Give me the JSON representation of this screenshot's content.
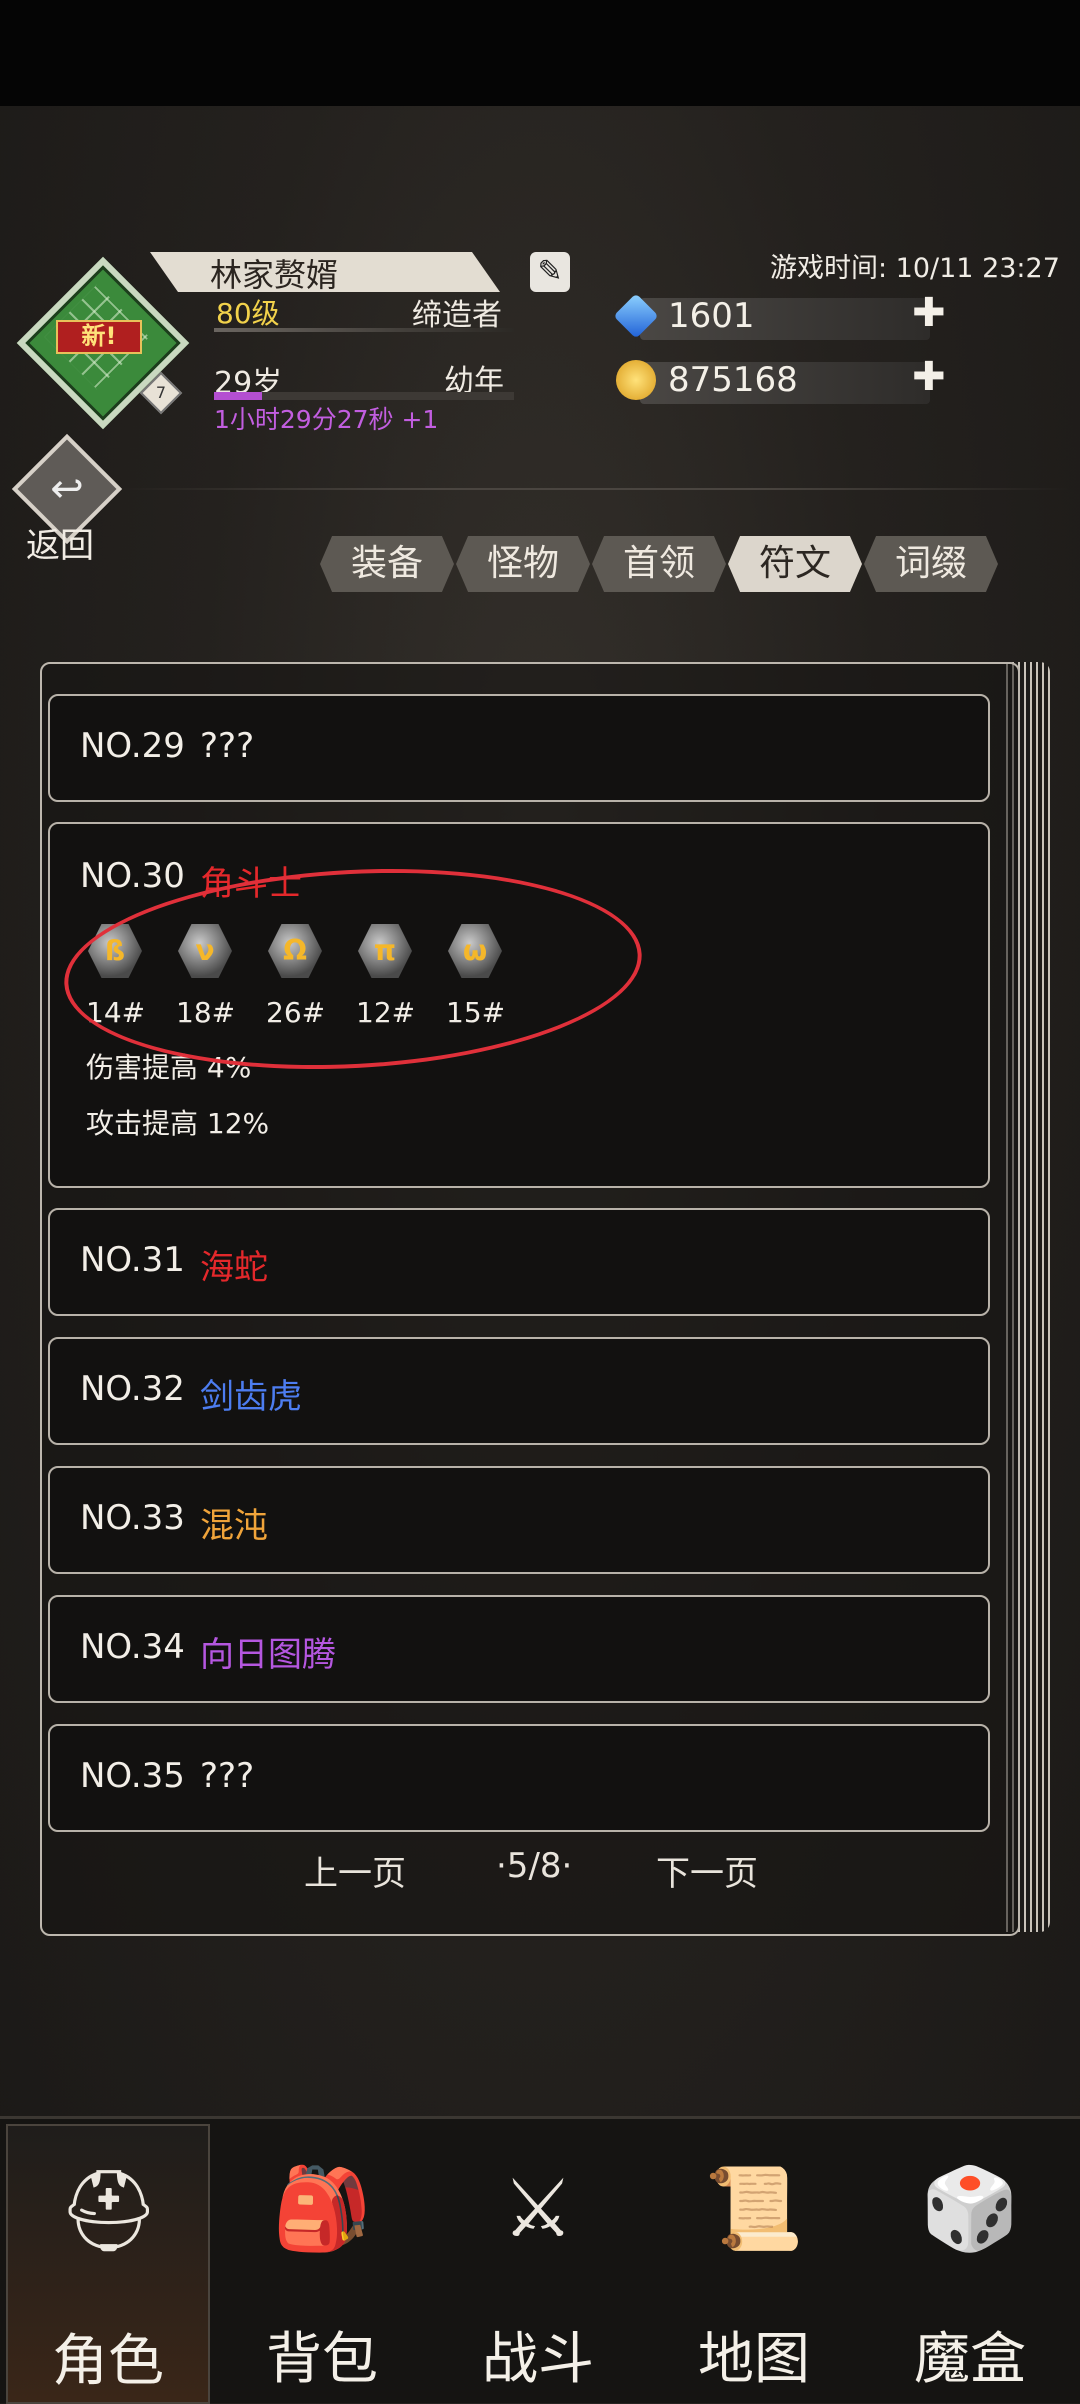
{
  "player": {
    "avatar_badge": "新!",
    "avatar_level": "7",
    "name": "林家赘婿",
    "level": "80级",
    "title": "缔造者",
    "age": "29岁",
    "stage": "幼年",
    "age_progress": 0.16,
    "timer": "1小时29分27秒 +1"
  },
  "game_time": "游戏时间: 10/11 23:27",
  "resources": {
    "gems": "1601",
    "gold": "875168"
  },
  "back_label": "返回",
  "tabs": [
    "装备",
    "怪物",
    "首领",
    "符文",
    "词缀"
  ],
  "active_tab": "符文",
  "entries": [
    {
      "no": "NO.29",
      "name": "???",
      "color": "#f2eee7"
    },
    {
      "no": "NO.30",
      "name": "角斗士",
      "color": "#e4282b",
      "runes": [
        {
          "glyph": "ß",
          "num": "14#"
        },
        {
          "glyph": "ν",
          "num": "18#"
        },
        {
          "glyph": "Ω",
          "num": "26#"
        },
        {
          "glyph": "π",
          "num": "12#"
        },
        {
          "glyph": "ω",
          "num": "15#"
        }
      ],
      "effects": [
        "伤害提高 4%",
        "攻击提高 12%"
      ]
    },
    {
      "no": "NO.31",
      "name": "海蛇",
      "color": "#e4282b"
    },
    {
      "no": "NO.32",
      "name": "剑齿虎",
      "color": "#4d7df0"
    },
    {
      "no": "NO.33",
      "name": "混沌",
      "color": "#f0a43a"
    },
    {
      "no": "NO.34",
      "name": "向日图腾",
      "color": "#b557e0"
    },
    {
      "no": "NO.35",
      "name": "???",
      "color": "#f2eee7"
    }
  ],
  "pager": {
    "prev": "上一页",
    "page": "·5/8·",
    "next": "下一页"
  },
  "nav": [
    "角色",
    "背包",
    "战斗",
    "地图",
    "魔盒"
  ],
  "active_nav": "角色"
}
